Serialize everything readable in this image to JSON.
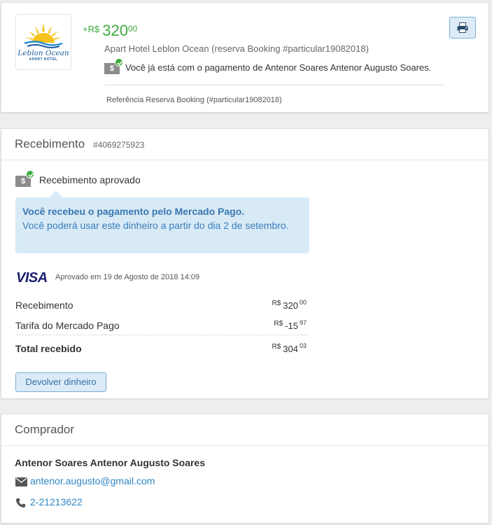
{
  "summary": {
    "logo": {
      "name": "Leblon Ocean",
      "sub": "APART HOTEL"
    },
    "amount": {
      "sign": "+R$",
      "integer": "320",
      "cents": "00"
    },
    "hotel_description": "Apart Hotel Leblon Ocean (reserva Booking #particular19082018)",
    "payment_message": "Você já está com o pagamento de Antenor Soares Antenor Augusto Soares.",
    "reference": "Referência Reserva Booking (#particular19082018)",
    "money_icon": "$",
    "print_icon": "print-icon"
  },
  "receipt": {
    "title": "Recebimento",
    "number": "#4069275923",
    "status_icon": "$",
    "status": "Recebimento aprovado",
    "info_title": "Você recebeu o pagamento pelo Mercado Pago.",
    "info_body": "Você poderá usar este dinheiro a partir do dia 2 de setembro.",
    "card_brand": "VISA",
    "approved_at": "Aprovado em 19 de Agosto de 2018 14:09",
    "lines": [
      {
        "label": "Recebimento",
        "currency": "R$",
        "integer": "320",
        "cents": "00"
      },
      {
        "label": "Tarifa do Mercado Pago",
        "currency": "R$",
        "integer": "-15",
        "cents": "97"
      }
    ],
    "total": {
      "label": "Total recebido",
      "currency": "R$",
      "integer": "304",
      "cents": "03"
    },
    "refund_button": "Devolver dinheiro"
  },
  "buyer": {
    "title": "Comprador",
    "name": "Antenor Soares Antenor Augusto Soares",
    "email": "antenor.augusto@gmail.com",
    "phone": "2-21213622"
  },
  "colors": {
    "green": "#3fab3f",
    "link_blue": "#2f86c5",
    "info_bg": "#d8eaf6",
    "button_bg": "#dcebf7",
    "visa_blue": "#1a1f71"
  }
}
